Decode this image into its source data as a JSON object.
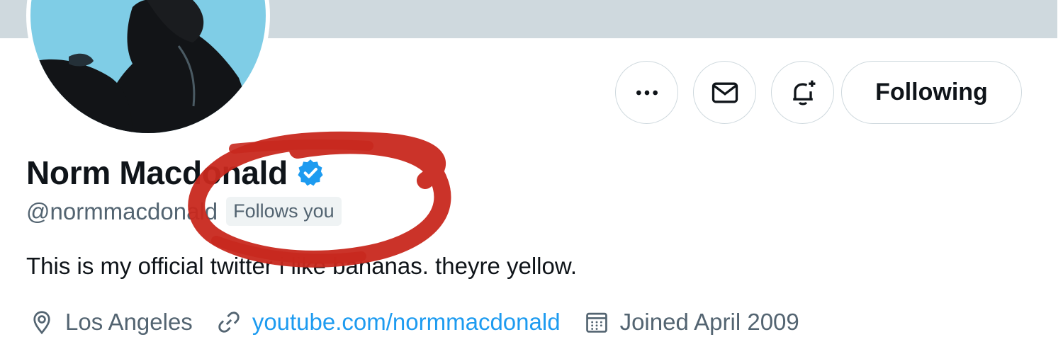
{
  "profile": {
    "name": "Norm Macdonald",
    "handle": "@normmacdonald",
    "follows_you": "Follows you",
    "bio": "This is my official twitter i like bananas. theyre yellow.",
    "location": "Los Angeles",
    "website": "youtube.com/normmacdonald",
    "joined": "Joined April 2009"
  },
  "actions": {
    "follow_label": "Following"
  },
  "icons": {
    "more": "more-icon",
    "message": "envelope-icon",
    "notify": "bell-plus-icon",
    "verified": "verified-badge-icon",
    "location": "location-pin-icon",
    "link": "link-icon",
    "calendar": "calendar-icon"
  },
  "colors": {
    "accent": "#1d9bf0",
    "secondary_text": "#536471",
    "annotation": "#c8281e"
  }
}
